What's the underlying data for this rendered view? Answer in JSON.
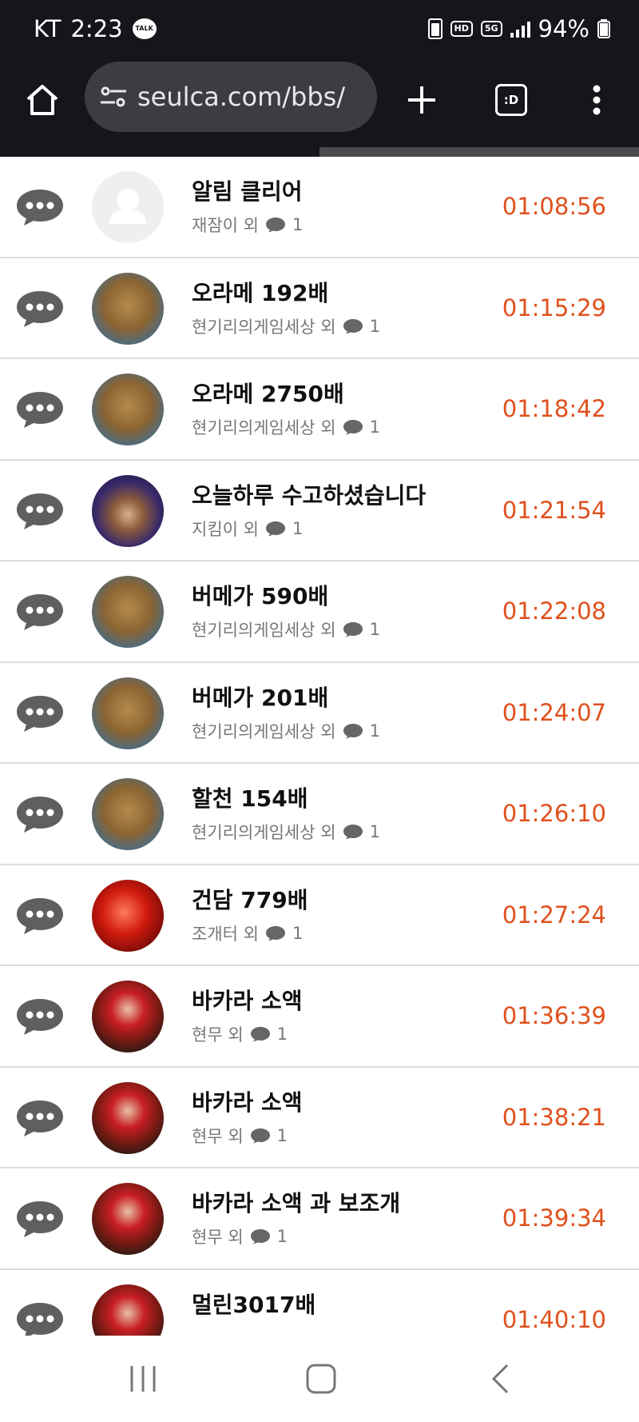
{
  "status_bar": {
    "carrier": "KT",
    "time": "2:23",
    "talk_badge": "TALK",
    "hd_badge": "HD",
    "network": "5G",
    "battery": "94%"
  },
  "browser": {
    "url": "seulca.com/bbs/",
    "tab_label": ":D",
    "load_progress": 0.5
  },
  "posts": [
    {
      "title": "알림 클리어",
      "author": "재잠이 외",
      "comments": "1",
      "time": "01:08:56",
      "avatar": "default"
    },
    {
      "title": "오라메 192배",
      "author": "현기리의게임세상 외",
      "comments": "1",
      "time": "01:15:29",
      "avatar": "cat"
    },
    {
      "title": "오라메 2750배",
      "author": "현기리의게임세상 외",
      "comments": "1",
      "time": "01:18:42",
      "avatar": "cat"
    },
    {
      "title": "오늘하루 수고하셨습니다",
      "author": "지킴이 외",
      "comments": "1",
      "time": "01:21:54",
      "avatar": "wizard"
    },
    {
      "title": "버메가 590배",
      "author": "현기리의게임세상 외",
      "comments": "1",
      "time": "01:22:08",
      "avatar": "cat"
    },
    {
      "title": "버메가 201배",
      "author": "현기리의게임세상 외",
      "comments": "1",
      "time": "01:24:07",
      "avatar": "cat"
    },
    {
      "title": "할천 154배",
      "author": "현기리의게임세상 외",
      "comments": "1",
      "time": "01:26:10",
      "avatar": "cat"
    },
    {
      "title": "건담 779배",
      "author": "조개터 외",
      "comments": "1",
      "time": "01:27:24",
      "avatar": "coke"
    },
    {
      "title": "바카라 소액",
      "author": "현무 외",
      "comments": "1",
      "time": "01:36:39",
      "avatar": "dealer"
    },
    {
      "title": "바카라 소액",
      "author": "현무 외",
      "comments": "1",
      "time": "01:38:21",
      "avatar": "dealer"
    },
    {
      "title": "바카라 소액 과 보조개",
      "author": "현무 외",
      "comments": "1",
      "time": "01:39:34",
      "avatar": "dealer"
    },
    {
      "title": "멀린3017배",
      "author": "",
      "comments": "",
      "time": "01:40:10",
      "avatar": "dealer"
    }
  ],
  "colors": {
    "time_accent": "#e0501d",
    "chat_icon": "#5f5f5f",
    "toolbar_bg": "#14161b"
  },
  "icons": {
    "home": "home-icon",
    "site_settings": "tune-icon",
    "new_tab": "plus-icon",
    "tabs": "tab-switcher-icon",
    "menu": "more-vert-icon",
    "row_marker": "chat-bubble-icon",
    "comment": "comment-icon",
    "nav_recents": "recents-icon",
    "nav_home": "nav-home-icon",
    "nav_back": "back-icon"
  }
}
